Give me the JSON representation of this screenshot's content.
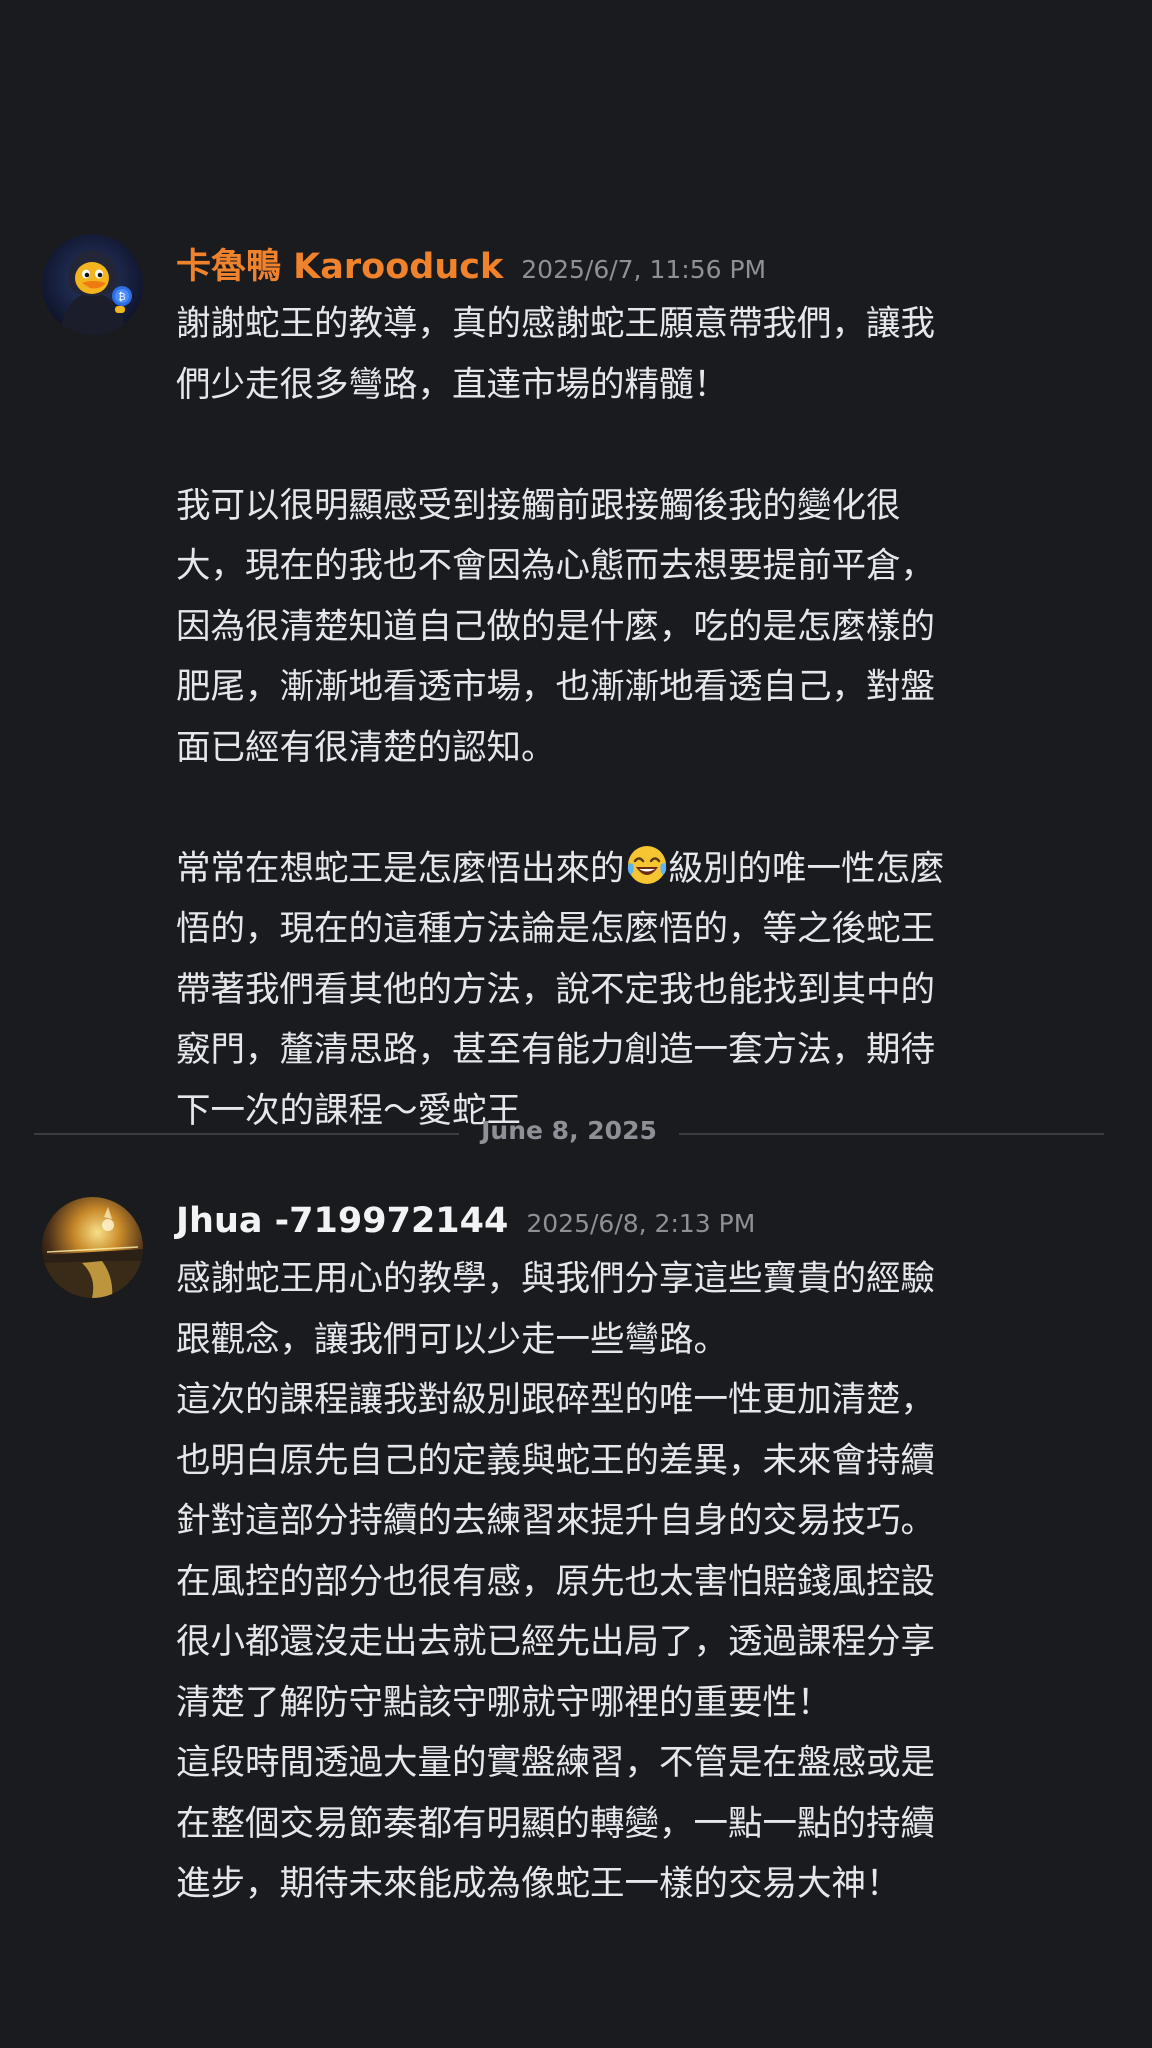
{
  "messages": [
    {
      "username": "卡魯鴨 Karooduck",
      "timestamp": "2025/6/7, 11:56 PM",
      "lines": [
        "謝謝蛇王的教導，真的感謝蛇王願意帶我們，讓我",
        "們少走很多彎路，直達市場的精髓！",
        "",
        "我可以很明顯感受到接觸前跟接觸後我的變化很",
        "大，現在的我也不會因為心態而去想要提前平倉，",
        "因為很清楚知道自己做的是什麼，吃的是怎麼樣的",
        "肥尾，漸漸地看透市場，也漸漸地看透自己，對盤",
        "面已經有很清楚的認知。",
        ""
      ],
      "emoji_line_before": "常常在想蛇王是怎麼悟出來的",
      "emoji_name": "laughing-tears-emoji",
      "emoji_line_after": "級別的唯一性怎麼",
      "lines_after": [
        "悟的，現在的這種方法論是怎麼悟的，等之後蛇王",
        "帶著我們看其他的方法，說不定我也能找到其中的",
        "竅門，釐清思路，甚至有能力創造一套方法，期待",
        "下一次的課程～愛蛇王"
      ]
    },
    {
      "username": "Jhua -719972144",
      "timestamp": "2025/6/8, 2:13 PM",
      "lines": [
        "感謝蛇王用心的教學，與我們分享這些寶貴的經驗",
        "跟觀念，讓我們可以少走一些彎路。",
        "這次的課程讓我對級別跟碎型的唯一性更加清楚，",
        "也明白原先自己的定義與蛇王的差異，未來會持續",
        "針對這部分持續的去練習來提升自身的交易技巧。",
        "在風控的部分也很有感，原先也太害怕賠錢風控設",
        "很小都還沒走出去就已經先出局了，透過課程分享",
        "清楚了解防守點該守哪就守哪裡的重要性！",
        "這段時間透過大量的實盤練習，不管是在盤感或是",
        "在整個交易節奏都有明顯的轉變，一點一點的持續",
        "進步，期待未來能成為像蛇王一樣的交易大神！"
      ]
    }
  ],
  "date_divider": "June 8, 2025",
  "colors": {
    "background": "#1a1b1e",
    "username_orange": "#f0822c",
    "username_white": "#f2f3f5",
    "timestamp": "#8d9096",
    "body_text": "#e6e7ea",
    "divider": "#3a3c41"
  }
}
